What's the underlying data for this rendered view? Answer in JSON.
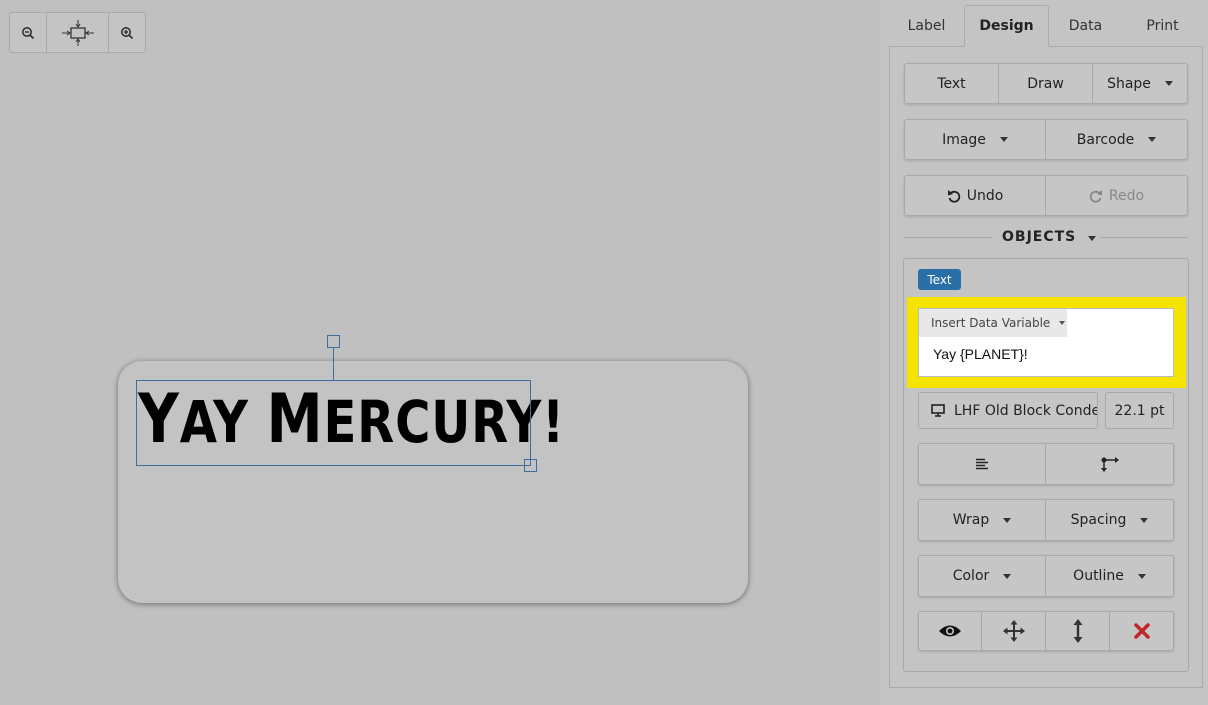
{
  "canvas": {
    "zoom_controls": [
      "zoom-out-icon",
      "fit-to-screen-icon",
      "zoom-in-icon"
    ],
    "label_text": {
      "first": "Y",
      "rest1": "AY ",
      "cap2": "M",
      "rest2": "ERCURY!"
    }
  },
  "tabs": [
    "Label",
    "Design",
    "Data",
    "Print"
  ],
  "active_tab": "Design",
  "design": {
    "row1": {
      "text": "Text",
      "draw": "Draw",
      "shape": "Shape"
    },
    "row2": {
      "image": "Image",
      "barcode": "Barcode"
    },
    "row3": {
      "undo": "Undo",
      "redo": "Redo"
    },
    "objects_title": "OBJECTS",
    "object_badge": "Text",
    "insert_variable": "Insert Data Variable",
    "editor_value": "Yay {PLANET}!",
    "font_name": "LHF Old Block Condensed",
    "font_size": "22.1 pt",
    "wrap": "Wrap",
    "spacing": "Spacing",
    "color": "Color",
    "outline": "Outline"
  },
  "colors": {
    "highlight": "#f5e400",
    "badge": "#2b6fa8",
    "delete": "#c0282c",
    "selection": "#3f6d9e"
  }
}
